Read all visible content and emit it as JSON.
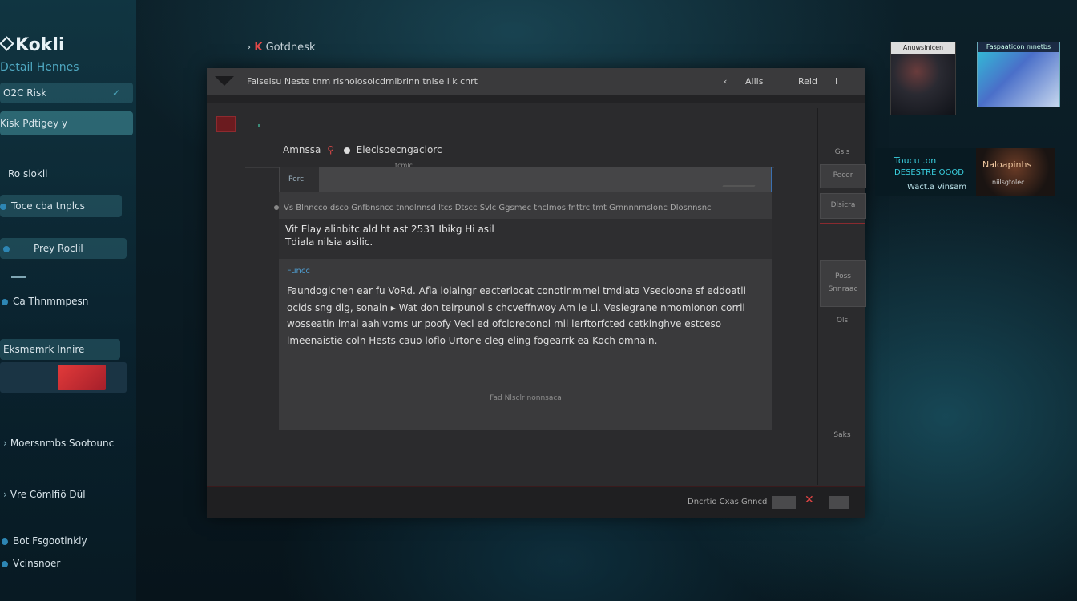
{
  "app": {
    "name": "Kokli",
    "subtitle": "Detail Hennes"
  },
  "sidebar": {
    "items": [
      {
        "label": "O2C Risk"
      },
      {
        "label": "Kisk  Pdtigey y"
      },
      {
        "label": "Ro slokli"
      },
      {
        "label": "Toce  cba tnplcs"
      },
      {
        "label": "Prey Roclil"
      },
      {
        "label": "Ca  Thnmmpesn"
      },
      {
        "label": "Eksmemrk Innire"
      },
      {
        "label": "Moersnmbs  Sootounc"
      },
      {
        "label": "Vre Cömlfiö Dül"
      },
      {
        "label": "Bot Fsgootinkly"
      },
      {
        "label": "Vcinsnoer"
      }
    ]
  },
  "breadcrumb": {
    "prefix": "K",
    "label": "Gotdnesk"
  },
  "window": {
    "title": "Falseisu    Neste tnm risnolosolcdrnibrinn tnlse l k cnrt",
    "toolbar": [
      "Alils",
      "Reid",
      "I"
    ],
    "header": "Amnssa",
    "header_suffix": "Elecisoecngaclorc",
    "sub_label": "tcmlc",
    "panel": {
      "tab_label": "Perc",
      "bullet_row": "Vs  Blnncco  dsco Gnfbnsncc tnnolnnsd  ltcs   Dtscc  Svlc   Ggsmec tnclmos   fnttrc  tmt Grnnnnmslonc  Dlosnnsnc",
      "info_line1": "Vit  Elay  alinbitc ald  ht ast  2531  Ibikg  Hi asil",
      "info_line2": "Tdiala  nilsia  asilic.",
      "section_title": "Funcc",
      "body": "Faundogichen ear fu VoRd. Afla lolaingr eacterlocat  conotinmmel tmdiata  Vsecloone  sf eddoatli ocids  sng dlg, sonain  ▸ Wat don teirpunol s chcveffnwoy Am ie Li.  Vesiegrane nmomlonon corril wosseatin  lmal aahivoms ur poofy  Vecl ed ofcloreconol mil lerftorfcted  cetkinghve estceso lmeenaistie coln  Hests cauo  loflo Urtone cleg eling fogearrk  ea  Koch omnain.",
      "footer_note": "Fad Nlsclr nonnsaca"
    },
    "right_rail": [
      "Gsls",
      "Pecer",
      "Dlsicra",
      "Poss",
      "Snnraac",
      "Ols",
      "Saks"
    ],
    "bottom": {
      "status": "Dncrtio   Cxas Gnncd"
    }
  },
  "thumbnails": {
    "thumb1_title": "Anuwsinicen",
    "thumb2_title": "Faspaaticon mnetbs"
  },
  "promo_card": {
    "line1": "Toucu  .on",
    "line2": "DESESTRE  OOOD",
    "line3": "Wact.a  Vinsam",
    "image_title": "Naloapinhs",
    "image_sub": "niilsgtolec"
  }
}
